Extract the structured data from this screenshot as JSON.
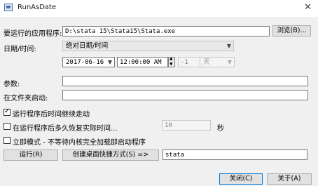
{
  "window": {
    "title": "RunAsDate",
    "close_glyph": "✕"
  },
  "program": {
    "label": "要运行的应用程序:",
    "value": "D:\\stata 15\\Stata15\\Stata.exe",
    "browse_label": "浏览(B)..."
  },
  "datetime": {
    "label": "日期/时间:",
    "mode": "绝对日期/时间",
    "date": "2017-06-16",
    "time": "12:00:00 AM",
    "offset": "-1",
    "unit": "天"
  },
  "params": {
    "label": "参数:",
    "value": ""
  },
  "startdir": {
    "label": "在文件夹启动:",
    "value": ""
  },
  "options": {
    "keep_moving": {
      "label": "运行程序后时间继续走动",
      "checked": true
    },
    "restore": {
      "label": "在运行程序后多久恢复实际时间...",
      "checked": false,
      "value": "10",
      "unit": "秒"
    },
    "immediate": {
      "label": "立即模式 - 不等待内核完全加载即启动程序",
      "checked": false
    }
  },
  "actions": {
    "run_label": "运行(R)",
    "shortcut_label": "创建桌面快捷方式(S) =>",
    "shortcut_name": "stata"
  },
  "footer": {
    "close_label": "关闭(C)",
    "about_label": "关于(A)"
  }
}
